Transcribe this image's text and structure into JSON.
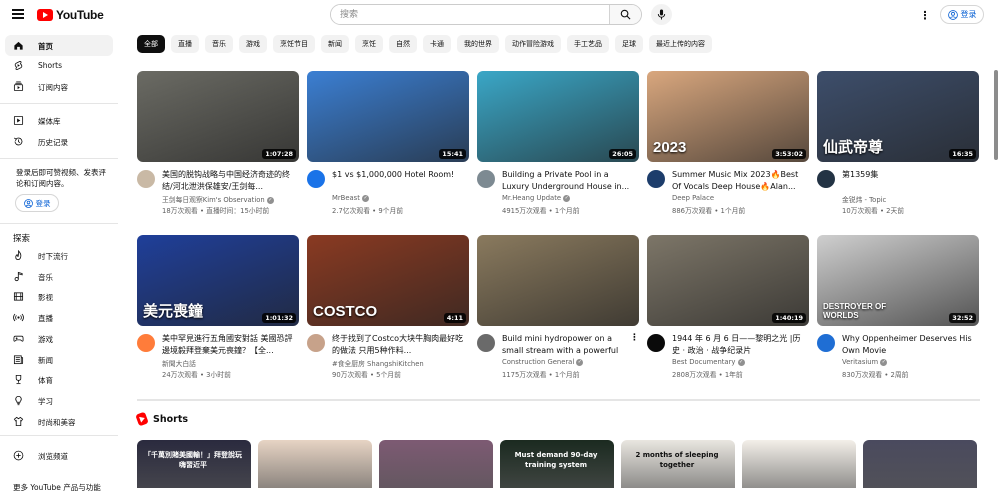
{
  "header": {
    "logo_text": "YouTube",
    "search_placeholder": "搜索",
    "signin_label": "登录"
  },
  "sidebar": {
    "primary": [
      {
        "label": "首页",
        "icon": "home-icon"
      },
      {
        "label": "Shorts",
        "icon": "shorts-icon"
      },
      {
        "label": "订阅内容",
        "icon": "subscriptions-icon"
      }
    ],
    "library": [
      {
        "label": "媒体库",
        "icon": "library-icon"
      },
      {
        "label": "历史记录",
        "icon": "history-icon"
      }
    ],
    "signin_note": "登录后即可赞视频、发表评论和订阅内容。",
    "signin_label": "登录",
    "explore_heading": "探索",
    "explore": [
      {
        "label": "时下流行",
        "icon": "trending-icon"
      },
      {
        "label": "音乐",
        "icon": "music-icon"
      },
      {
        "label": "影视",
        "icon": "movies-icon"
      },
      {
        "label": "直播",
        "icon": "live-icon"
      },
      {
        "label": "游戏",
        "icon": "gaming-icon"
      },
      {
        "label": "新闻",
        "icon": "news-icon"
      },
      {
        "label": "体育",
        "icon": "sports-icon"
      },
      {
        "label": "学习",
        "icon": "learning-icon"
      },
      {
        "label": "时尚和美容",
        "icon": "fashion-icon"
      }
    ],
    "browse": {
      "label": "浏览频道",
      "icon": "browse-channels-icon"
    },
    "more_label": "更多 YouTube 产品与功能"
  },
  "chips": [
    "全部",
    "直播",
    "音乐",
    "游戏",
    "烹饪节目",
    "新闻",
    "烹饪",
    "自然",
    "卡通",
    "我的世界",
    "动作冒险游戏",
    "手工艺品",
    "足球",
    "最近上传的内容"
  ],
  "videos": [
    {
      "title": "美国的脱钩战略与中国经济奇迹的终结/河北泄洪保雄安/王剑每...",
      "channel": "王剑每日观察Kim's Observation",
      "verified": true,
      "stats": "18万次观看 • 直播时间：15小时前",
      "duration": "1:07:28",
      "thumb_bg": "#6b6b64",
      "avatar_bg": "#c9b9a5"
    },
    {
      "title": "$1 vs $1,000,000 Hotel Room!",
      "channel": "MrBeast",
      "verified": true,
      "stats": "2.7亿次观看 • 9个月前",
      "duration": "15:41",
      "thumb_bg": "#3b7fd3",
      "avatar_bg": "#1a73e8"
    },
    {
      "title": "Building a Private Pool in a Luxury Underground House in...",
      "channel": "Mr.Heang Update",
      "verified": true,
      "stats": "4915万次观看 • 1个月前",
      "duration": "26:05",
      "thumb_bg": "#3aa7c7",
      "avatar_bg": "#7d8a92"
    },
    {
      "title": "Summer Music Mix 2023🔥Best Of Vocals Deep House🔥Alan...",
      "channel": "Deep Palace",
      "verified": false,
      "stats": "886万次观看 • 1个月前",
      "duration": "3:53:02",
      "thumb_bg": "#d9a77e",
      "avatar_bg": "#1d3d6b",
      "thumb_text": "2023"
    },
    {
      "title": "第1359集",
      "channel": "金锐炜 - Topic",
      "verified": false,
      "stats": "10万次观看 • 2天前",
      "duration": "16:35",
      "thumb_bg": "#3d4e6b",
      "avatar_bg": "#233344",
      "thumb_text": "仙武帝尊"
    },
    {
      "title": "美中罕見進行五角國安對話 美國恐評邊境毅拜登棄美元喪鐘？【全...",
      "channel": "新聞大白話",
      "verified": false,
      "stats": "24万次观看 • 3小时前",
      "duration": "1:01:32",
      "thumb_bg": "#1f3f9a",
      "avatar_bg": "#ff7c3a",
      "thumb_text": "美元喪鐘"
    },
    {
      "title": "终于找到了Costco大块牛胸肉最好吃的做法 只用5种作料...",
      "channel": "#食全厨房 ShangshiKitchen",
      "verified": false,
      "stats": "90万次观看 • 5个月前",
      "duration": "4:11",
      "thumb_bg": "#8a3a22",
      "avatar_bg": "#c7a28a",
      "thumb_text": "COSTCO"
    },
    {
      "title": "Build mini hydropower on a small stream with a powerful unit",
      "channel": "Construction General",
      "verified": true,
      "stats": "1175万次观看 • 1个月前",
      "duration": "",
      "thumb_bg": "#8a7a5e",
      "avatar_bg": "#6a6a6a"
    },
    {
      "title": "1944 年 6 月 6 日——黎明之光 |历史 · 政治 · 战争纪录片",
      "channel": "Best Documentary",
      "verified": true,
      "stats": "2808万次观看 • 1年前",
      "duration": "1:40:19",
      "thumb_bg": "#7d7668",
      "avatar_bg": "#0a0a0a"
    },
    {
      "title": "Why Oppenheimer Deserves His Own Movie",
      "channel": "Veritasium",
      "verified": true,
      "stats": "830万次观看 • 2周前",
      "duration": "32:52",
      "thumb_bg": "#cfcfcf",
      "avatar_bg": "#1f6ed4",
      "thumb_text": "DESTROYER OF WORLDS"
    }
  ],
  "shorts": {
    "heading": "Shorts",
    "items": [
      {
        "bg": "#2a2a3e",
        "text": "「千萬別賭美國輸！」拜登說玩嗨習近平"
      },
      {
        "bg": "#e7d4c4",
        "text": ""
      },
      {
        "bg": "#7d5a73",
        "text": ""
      },
      {
        "bg": "#1b2a20",
        "text": "Must demand 90-day training system"
      },
      {
        "bg": "#e9e6e0",
        "text": "2 months of sleeping together"
      },
      {
        "bg": "#f3efe9",
        "text": ""
      },
      {
        "bg": "#4a4a5e",
        "text": ""
      }
    ]
  },
  "colors": {
    "accent": "#ff0000",
    "link": "#065fd4",
    "chip_bg": "#f2f2f2",
    "chip_active": "#0f0f0f"
  }
}
